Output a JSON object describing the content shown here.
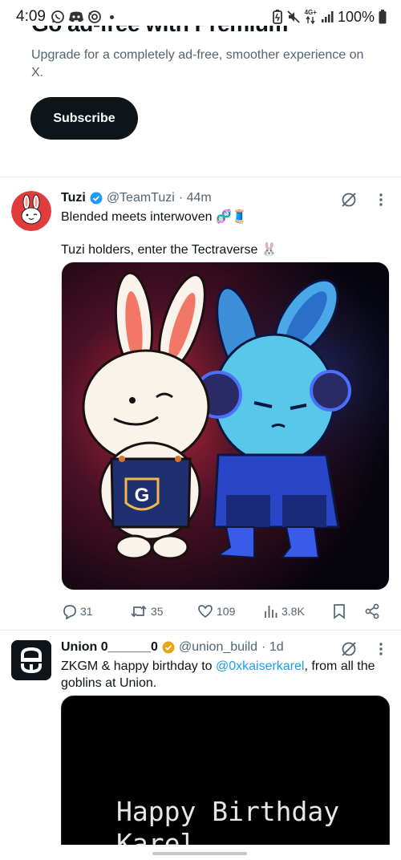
{
  "status_bar": {
    "time": "4:09",
    "battery": "100%",
    "network": "4G+",
    "icons": [
      "whatsapp-icon",
      "discord-icon",
      "sync-icon",
      "dot-icon",
      "battery-saver-icon",
      "mute-icon",
      "data-arrows-icon",
      "signal-icon",
      "battery-icon"
    ]
  },
  "premium": {
    "title": "Go ad-free with Premium",
    "description": "Upgrade for a completely ad-free, smoother experience on X.",
    "subscribe_label": "Subscribe"
  },
  "tweets": [
    {
      "name": "Tuzi",
      "verified_color": "#1d9bf0",
      "handle": "@TeamTuzi",
      "time": "· 44m",
      "line1": "Blended meets interwoven 🧬🧵",
      "line2": "Tuzi holders, enter the Tectraverse 🐰",
      "actions": {
        "replies": "31",
        "retweets": "35",
        "likes": "109",
        "views": "3.8K"
      }
    },
    {
      "name": "Union 0______0",
      "verified_color": "#e8a317",
      "handle": "@union_build",
      "time": "· 1d",
      "text_before": "ZKGM & happy birthday to ",
      "mention": "@0xkaiserkarel",
      "text_after": ", from all the goblins at Union.",
      "media_text_line1": "Happy Birthday",
      "media_text_line2": "Karel"
    }
  ],
  "colors": {
    "accent": "#1d9bf0",
    "text": "#0f1419",
    "muted": "#536471"
  }
}
